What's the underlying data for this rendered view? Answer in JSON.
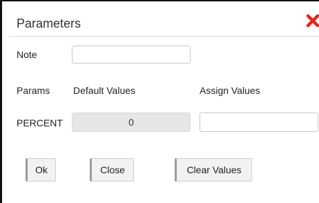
{
  "dialog": {
    "title": "Parameters",
    "note_label": "Note",
    "note_value": "",
    "params_header": "Params",
    "default_header": "Default Values",
    "assign_header": "Assign Values",
    "rows": [
      {
        "param": "PERCENT",
        "default": "0",
        "assign": ""
      }
    ],
    "buttons": {
      "ok": "Ok",
      "close": "Close",
      "clear": "Clear Values"
    },
    "close_icon": "close-x-icon",
    "close_icon_color": "#e8231a"
  }
}
